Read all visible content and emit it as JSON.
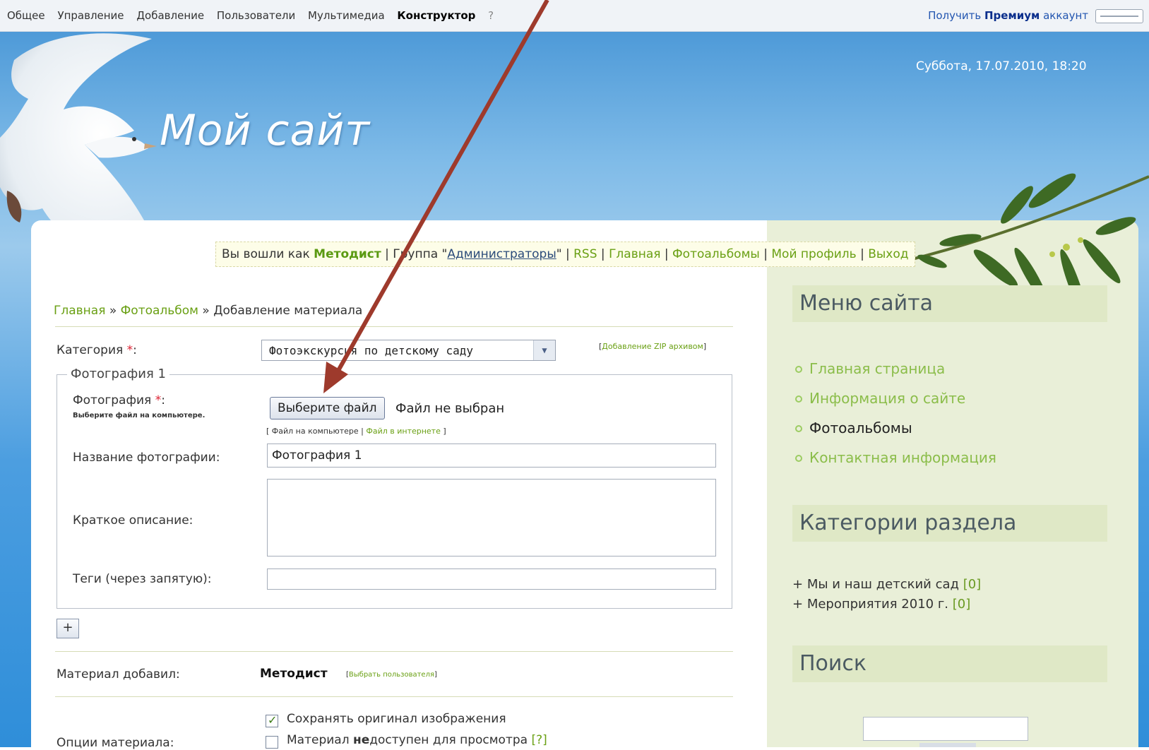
{
  "topbar": {
    "menu": [
      "Общее",
      "Управление",
      "Добавление",
      "Пользователи",
      "Мультимедиа",
      "Конструктор",
      "?"
    ],
    "premium_prefix": "Получить",
    "premium_bold": "Премиум",
    "premium_suffix": "аккаунт"
  },
  "header": {
    "site_title": "Мой сайт",
    "datetime": "Суббота, 17.07.2010, 18:20"
  },
  "loginbar": {
    "prefix": "Вы вошли как",
    "user": "Методист",
    "group_prefix": " | Группа \"",
    "group": "Администраторы",
    "group_suffix": "\" | ",
    "links": [
      "RSS",
      "Главная",
      "Фотоальбомы",
      "Мой профиль",
      "Выход"
    ]
  },
  "breadcrumb": {
    "home": "Главная",
    "sep": " » ",
    "section": "Фотоальбом",
    "current": "Добавление материала"
  },
  "form": {
    "category_label": "Категория",
    "required_mark": "*",
    "category_value": "Фотоэкскурсия по детскому саду",
    "zip_link": "Добавление ZIP архивом",
    "fieldset_legend": "Фотография 1",
    "photo_label": "Фотография",
    "photo_hint": "Выберите файл на компьютере.",
    "file_button": "Выберите файл",
    "file_status": "Файл не выбран",
    "file_source_local": "Файл на компьютере",
    "file_source_web": "Файл в интернете",
    "photo_name_label": "Название фотографии:",
    "photo_name_value": "Фотография 1",
    "short_desc_label": "Краткое описание:",
    "tags_label": "Теги (через запятую):",
    "plus_button": "+",
    "added_by_label": "Материал добавил:",
    "added_by_value": "Методист",
    "select_user_link": "Выбрать пользователя",
    "options_label": "Опции материала:",
    "option_keep_original": "Сохранять оригинал изображения",
    "option_hidden_prefix": "Материал ",
    "option_hidden_bold": "не",
    "option_hidden_suffix": "доступен для просмотра",
    "option_help": "[?]"
  },
  "sidebar": {
    "menu_title": "Меню сайта",
    "menu_items": [
      "Главная страница",
      "Информация о сайте",
      "Фотоальбомы",
      "Контактная информация"
    ],
    "categories_title": "Категории раздела",
    "categories": [
      {
        "name": "Мы и наш детский сад",
        "count": "[0]"
      },
      {
        "name": "Мероприятия 2010 г.",
        "count": "[0]"
      }
    ],
    "search_title": "Поиск"
  },
  "colors": {
    "link_green": "#6aa014",
    "sidebar_bg": "#e9efd8",
    "arrow": "#9e3a2c"
  }
}
